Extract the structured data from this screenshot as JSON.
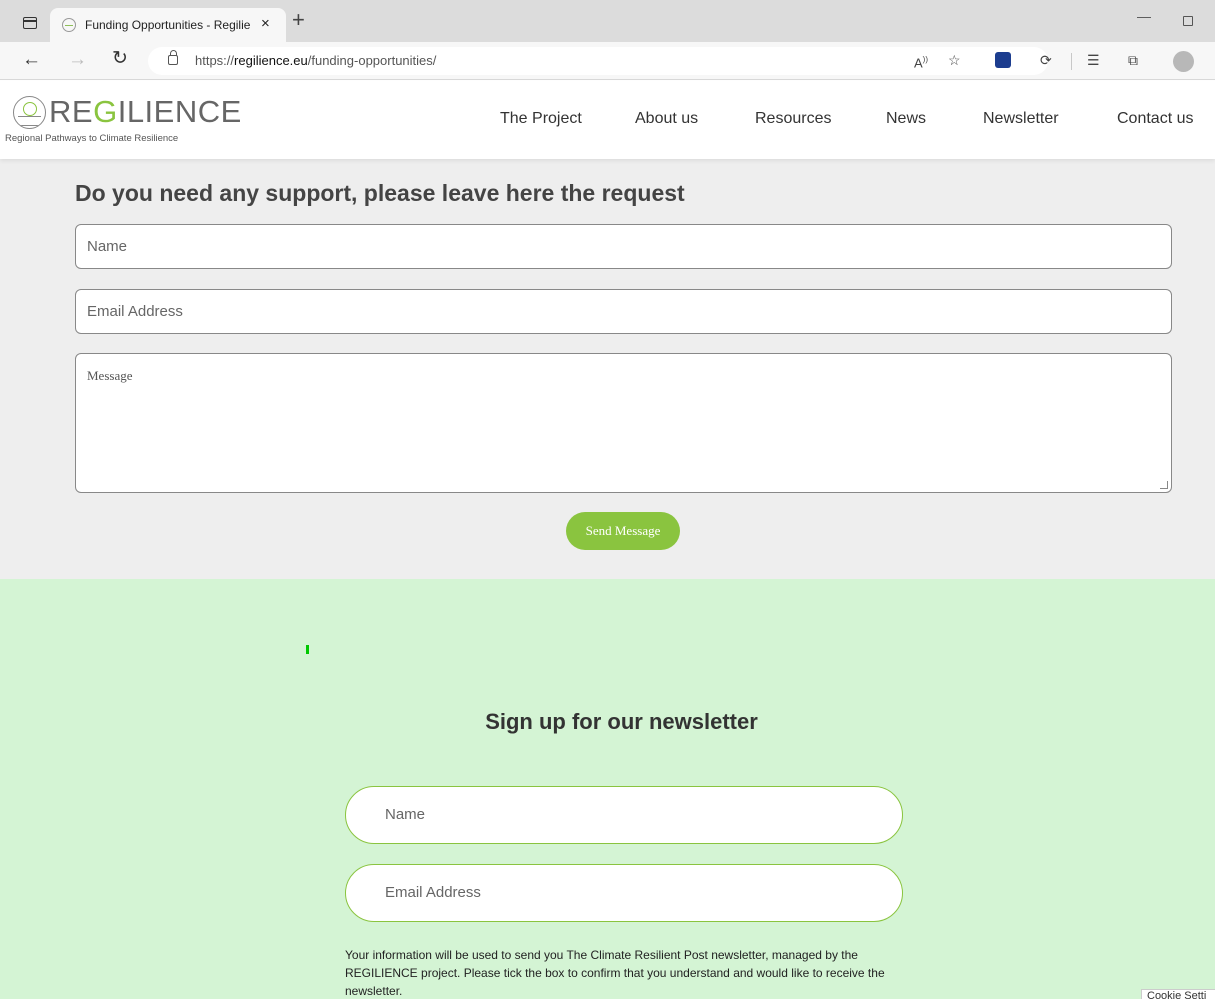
{
  "browser": {
    "tab_title": "Funding Opportunities - Regilien",
    "tab_close": "×",
    "new_tab": "+",
    "url_prefix": "https://",
    "url_domain": "regilience.eu",
    "url_path": "/funding-opportunities/",
    "read_aloud": "A",
    "window_minimize": "—"
  },
  "header": {
    "logo_prefix": "RE",
    "logo_highlight": "G",
    "logo_suffix": "ILIENCE",
    "logo_subtitle": "Regional Pathways to Climate Resilience",
    "nav": [
      "The Project",
      "About us",
      "Resources",
      "News",
      "Newsletter",
      "Contact us"
    ]
  },
  "contact": {
    "title": "Do you need any support, please leave here the request",
    "name_placeholder": "Name",
    "email_placeholder": "Email Address",
    "message_placeholder": "Message",
    "send_label": "Send Message"
  },
  "newsletter": {
    "title": "Sign up for our newsletter",
    "name_placeholder": "Name",
    "email_placeholder": "Email Address",
    "disclaimer": "Your information will be used to send you The Climate Resilient Post newsletter, managed by the REGILIENCE project. Please tick the box to confirm that you understand and would like to receive the newsletter."
  },
  "cookie": {
    "label": "Cookie Setti"
  },
  "colors": {
    "accent": "#8ac43f",
    "newsletter_bg": "#d4f4d4",
    "contact_bg": "#eeeeee"
  }
}
